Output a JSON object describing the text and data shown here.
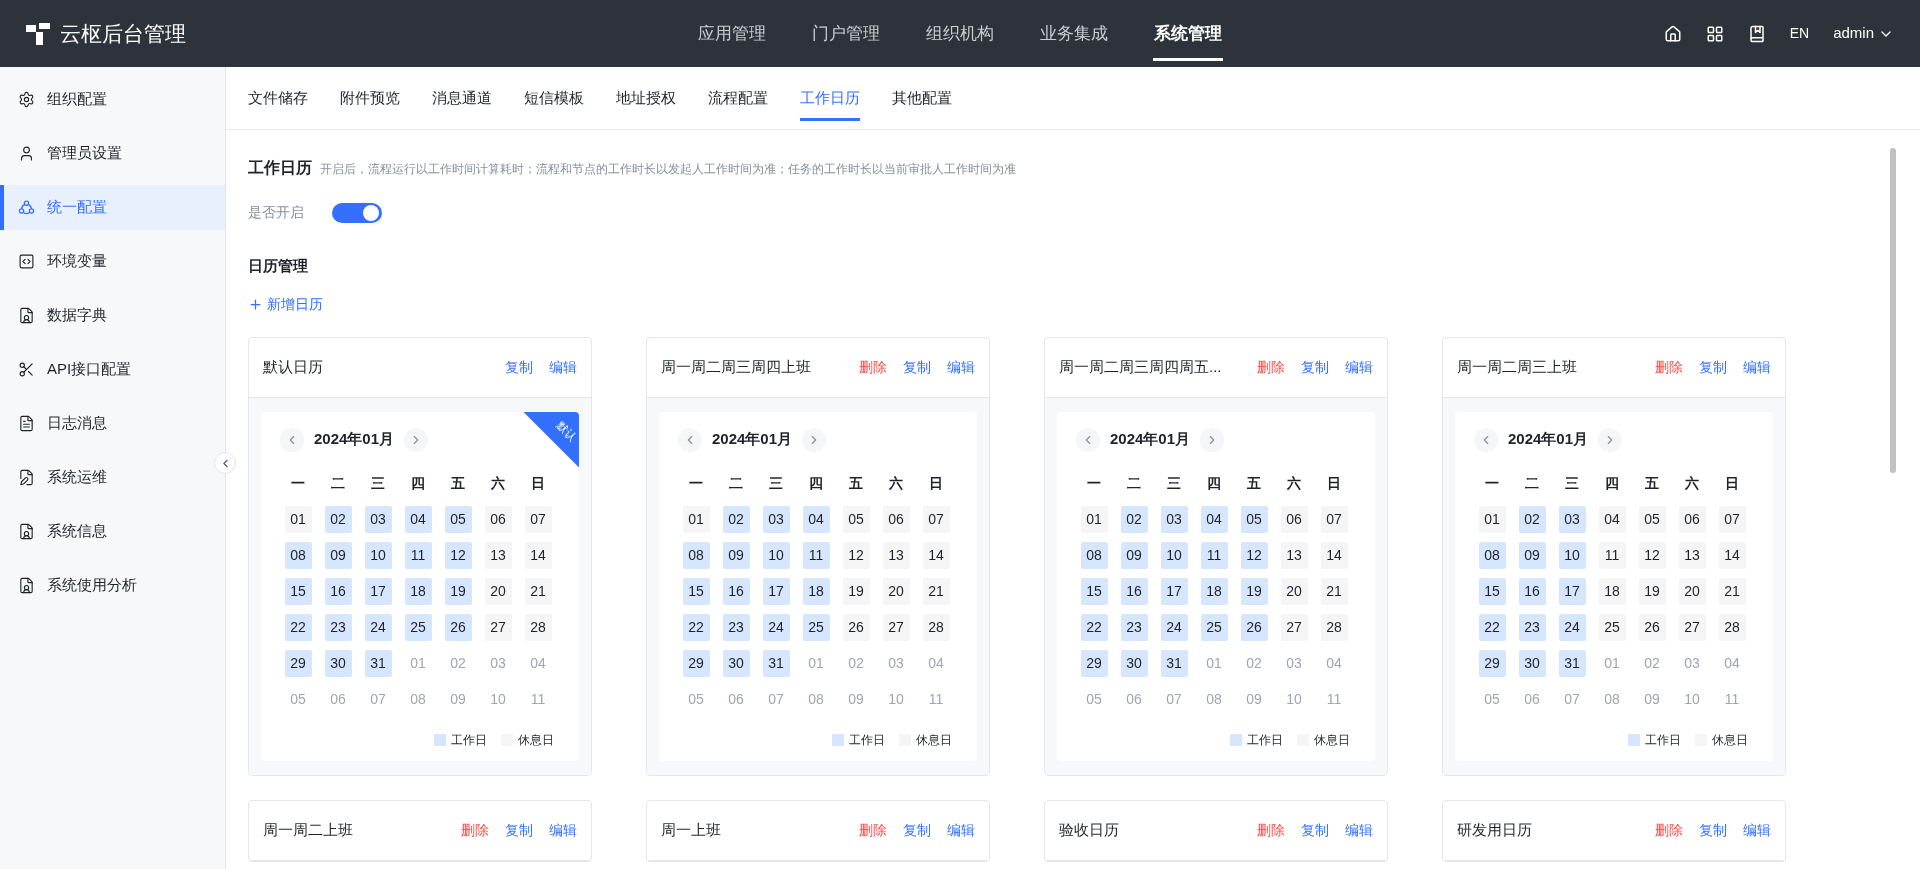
{
  "app": {
    "logo_text": "云枢后台管理"
  },
  "nav": [
    {
      "label": "应用管理",
      "selected": false
    },
    {
      "label": "门户管理",
      "selected": false
    },
    {
      "label": "组织机构",
      "selected": false
    },
    {
      "label": "业务集成",
      "selected": false
    },
    {
      "label": "系统管理",
      "selected": true
    }
  ],
  "header_right": {
    "lang": "EN",
    "user": "admin"
  },
  "sidebar": {
    "items": [
      {
        "label": "组织配置",
        "selected": false
      },
      {
        "label": "管理员设置",
        "selected": false
      },
      {
        "label": "统一配置",
        "selected": true
      },
      {
        "label": "环境变量",
        "selected": false
      },
      {
        "label": "数据字典",
        "selected": false
      },
      {
        "label": "API接口配置",
        "selected": false
      },
      {
        "label": "日志消息",
        "selected": false
      },
      {
        "label": "系统运维",
        "selected": false
      },
      {
        "label": "系统信息",
        "selected": false
      },
      {
        "label": "系统使用分析",
        "selected": false
      }
    ]
  },
  "tabs": [
    {
      "label": "文件储存",
      "selected": false
    },
    {
      "label": "附件预览",
      "selected": false
    },
    {
      "label": "消息通道",
      "selected": false
    },
    {
      "label": "短信模板",
      "selected": false
    },
    {
      "label": "地址授权",
      "selected": false
    },
    {
      "label": "流程配置",
      "selected": false
    },
    {
      "label": "工作日历",
      "selected": true
    },
    {
      "label": "其他配置",
      "selected": false
    }
  ],
  "section": {
    "title": "工作日历",
    "description": "开启后，流程运行以工作时间计算耗时；流程和节点的工作时长以发起人工作时间为准；任务的工作时长以当前审批人工作时间为准",
    "toggle_label": "是否开启",
    "enabled": true
  },
  "calendar_manager": {
    "title": "日历管理",
    "add_label": "新增日历"
  },
  "calendars": [
    {
      "title": "默认日历",
      "actions": [
        {
          "label": "复制",
          "kind": "copy"
        },
        {
          "label": "编辑",
          "kind": "edit"
        }
      ],
      "badge": "默认",
      "month": "2024年01月",
      "weekdays": [
        "一",
        "二",
        "三",
        "四",
        "五",
        "六",
        "日"
      ],
      "days": [
        {
          "d": "01",
          "kind": "rest"
        },
        {
          "d": "02",
          "kind": "work"
        },
        {
          "d": "03",
          "kind": "work"
        },
        {
          "d": "04",
          "kind": "work"
        },
        {
          "d": "05",
          "kind": "work"
        },
        {
          "d": "06",
          "kind": "rest"
        },
        {
          "d": "07",
          "kind": "rest"
        },
        {
          "d": "08",
          "kind": "work"
        },
        {
          "d": "09",
          "kind": "work"
        },
        {
          "d": "10",
          "kind": "work"
        },
        {
          "d": "11",
          "kind": "work"
        },
        {
          "d": "12",
          "kind": "work"
        },
        {
          "d": "13",
          "kind": "rest"
        },
        {
          "d": "14",
          "kind": "rest"
        },
        {
          "d": "15",
          "kind": "work"
        },
        {
          "d": "16",
          "kind": "work"
        },
        {
          "d": "17",
          "kind": "work"
        },
        {
          "d": "18",
          "kind": "work"
        },
        {
          "d": "19",
          "kind": "work"
        },
        {
          "d": "20",
          "kind": "rest"
        },
        {
          "d": "21",
          "kind": "rest"
        },
        {
          "d": "22",
          "kind": "work"
        },
        {
          "d": "23",
          "kind": "work"
        },
        {
          "d": "24",
          "kind": "work"
        },
        {
          "d": "25",
          "kind": "work"
        },
        {
          "d": "26",
          "kind": "work"
        },
        {
          "d": "27",
          "kind": "rest"
        },
        {
          "d": "28",
          "kind": "rest"
        },
        {
          "d": "29",
          "kind": "work"
        },
        {
          "d": "30",
          "kind": "work"
        },
        {
          "d": "31",
          "kind": "work"
        },
        {
          "d": "01",
          "kind": "other"
        },
        {
          "d": "02",
          "kind": "other"
        },
        {
          "d": "03",
          "kind": "other"
        },
        {
          "d": "04",
          "kind": "other"
        },
        {
          "d": "05",
          "kind": "other"
        },
        {
          "d": "06",
          "kind": "other"
        },
        {
          "d": "07",
          "kind": "other"
        },
        {
          "d": "08",
          "kind": "other"
        },
        {
          "d": "09",
          "kind": "other"
        },
        {
          "d": "10",
          "kind": "other"
        },
        {
          "d": "11",
          "kind": "other"
        }
      ],
      "legend": [
        {
          "label": "工作日",
          "kind": "work"
        },
        {
          "label": "休息日",
          "kind": "rest"
        }
      ]
    },
    {
      "title": "周一周二周三周四上班",
      "actions": [
        {
          "label": "删除",
          "kind": "delete"
        },
        {
          "label": "复制",
          "kind": "copy"
        },
        {
          "label": "编辑",
          "kind": "edit"
        }
      ],
      "month": "2024年01月",
      "weekdays": [
        "一",
        "二",
        "三",
        "四",
        "五",
        "六",
        "日"
      ],
      "days": [
        {
          "d": "01",
          "kind": "rest"
        },
        {
          "d": "02",
          "kind": "work"
        },
        {
          "d": "03",
          "kind": "work"
        },
        {
          "d": "04",
          "kind": "work"
        },
        {
          "d": "05",
          "kind": "rest"
        },
        {
          "d": "06",
          "kind": "rest"
        },
        {
          "d": "07",
          "kind": "rest"
        },
        {
          "d": "08",
          "kind": "work"
        },
        {
          "d": "09",
          "kind": "work"
        },
        {
          "d": "10",
          "kind": "work"
        },
        {
          "d": "11",
          "kind": "work"
        },
        {
          "d": "12",
          "kind": "rest"
        },
        {
          "d": "13",
          "kind": "rest"
        },
        {
          "d": "14",
          "kind": "rest"
        },
        {
          "d": "15",
          "kind": "work"
        },
        {
          "d": "16",
          "kind": "work"
        },
        {
          "d": "17",
          "kind": "work"
        },
        {
          "d": "18",
          "kind": "work"
        },
        {
          "d": "19",
          "kind": "rest"
        },
        {
          "d": "20",
          "kind": "rest"
        },
        {
          "d": "21",
          "kind": "rest"
        },
        {
          "d": "22",
          "kind": "work"
        },
        {
          "d": "23",
          "kind": "work"
        },
        {
          "d": "24",
          "kind": "work"
        },
        {
          "d": "25",
          "kind": "work"
        },
        {
          "d": "26",
          "kind": "rest"
        },
        {
          "d": "27",
          "kind": "rest"
        },
        {
          "d": "28",
          "kind": "rest"
        },
        {
          "d": "29",
          "kind": "work"
        },
        {
          "d": "30",
          "kind": "work"
        },
        {
          "d": "31",
          "kind": "work"
        },
        {
          "d": "01",
          "kind": "other"
        },
        {
          "d": "02",
          "kind": "other"
        },
        {
          "d": "03",
          "kind": "other"
        },
        {
          "d": "04",
          "kind": "other"
        },
        {
          "d": "05",
          "kind": "other"
        },
        {
          "d": "06",
          "kind": "other"
        },
        {
          "d": "07",
          "kind": "other"
        },
        {
          "d": "08",
          "kind": "other"
        },
        {
          "d": "09",
          "kind": "other"
        },
        {
          "d": "10",
          "kind": "other"
        },
        {
          "d": "11",
          "kind": "other"
        }
      ],
      "legend": [
        {
          "label": "工作日",
          "kind": "work"
        },
        {
          "label": "休息日",
          "kind": "rest"
        }
      ]
    },
    {
      "title": "周一周二周三周四周五...",
      "actions": [
        {
          "label": "删除",
          "kind": "delete"
        },
        {
          "label": "复制",
          "kind": "copy"
        },
        {
          "label": "编辑",
          "kind": "edit"
        }
      ],
      "month": "2024年01月",
      "weekdays": [
        "一",
        "二",
        "三",
        "四",
        "五",
        "六",
        "日"
      ],
      "days": [
        {
          "d": "01",
          "kind": "rest"
        },
        {
          "d": "02",
          "kind": "work"
        },
        {
          "d": "03",
          "kind": "work"
        },
        {
          "d": "04",
          "kind": "work"
        },
        {
          "d": "05",
          "kind": "work"
        },
        {
          "d": "06",
          "kind": "rest"
        },
        {
          "d": "07",
          "kind": "rest"
        },
        {
          "d": "08",
          "kind": "work"
        },
        {
          "d": "09",
          "kind": "work"
        },
        {
          "d": "10",
          "kind": "work"
        },
        {
          "d": "11",
          "kind": "work"
        },
        {
          "d": "12",
          "kind": "work"
        },
        {
          "d": "13",
          "kind": "rest"
        },
        {
          "d": "14",
          "kind": "rest"
        },
        {
          "d": "15",
          "kind": "work"
        },
        {
          "d": "16",
          "kind": "work"
        },
        {
          "d": "17",
          "kind": "work"
        },
        {
          "d": "18",
          "kind": "work"
        },
        {
          "d": "19",
          "kind": "work"
        },
        {
          "d": "20",
          "kind": "rest"
        },
        {
          "d": "21",
          "kind": "rest"
        },
        {
          "d": "22",
          "kind": "work"
        },
        {
          "d": "23",
          "kind": "work"
        },
        {
          "d": "24",
          "kind": "work"
        },
        {
          "d": "25",
          "kind": "work"
        },
        {
          "d": "26",
          "kind": "work"
        },
        {
          "d": "27",
          "kind": "rest"
        },
        {
          "d": "28",
          "kind": "rest"
        },
        {
          "d": "29",
          "kind": "work"
        },
        {
          "d": "30",
          "kind": "work"
        },
        {
          "d": "31",
          "kind": "work"
        },
        {
          "d": "01",
          "kind": "other"
        },
        {
          "d": "02",
          "kind": "other"
        },
        {
          "d": "03",
          "kind": "other"
        },
        {
          "d": "04",
          "kind": "other"
        },
        {
          "d": "05",
          "kind": "other"
        },
        {
          "d": "06",
          "kind": "other"
        },
        {
          "d": "07",
          "kind": "other"
        },
        {
          "d": "08",
          "kind": "other"
        },
        {
          "d": "09",
          "kind": "other"
        },
        {
          "d": "10",
          "kind": "other"
        },
        {
          "d": "11",
          "kind": "other"
        }
      ],
      "legend": [
        {
          "label": "工作日",
          "kind": "work"
        },
        {
          "label": "休息日",
          "kind": "rest"
        }
      ]
    },
    {
      "title": "周一周二周三上班",
      "actions": [
        {
          "label": "删除",
          "kind": "delete"
        },
        {
          "label": "复制",
          "kind": "copy"
        },
        {
          "label": "编辑",
          "kind": "edit"
        }
      ],
      "month": "2024年01月",
      "weekdays": [
        "一",
        "二",
        "三",
        "四",
        "五",
        "六",
        "日"
      ],
      "days": [
        {
          "d": "01",
          "kind": "rest"
        },
        {
          "d": "02",
          "kind": "work"
        },
        {
          "d": "03",
          "kind": "work"
        },
        {
          "d": "04",
          "kind": "rest"
        },
        {
          "d": "05",
          "kind": "rest"
        },
        {
          "d": "06",
          "kind": "rest"
        },
        {
          "d": "07",
          "kind": "rest"
        },
        {
          "d": "08",
          "kind": "work"
        },
        {
          "d": "09",
          "kind": "work"
        },
        {
          "d": "10",
          "kind": "work"
        },
        {
          "d": "11",
          "kind": "rest"
        },
        {
          "d": "12",
          "kind": "rest"
        },
        {
          "d": "13",
          "kind": "rest"
        },
        {
          "d": "14",
          "kind": "rest"
        },
        {
          "d": "15",
          "kind": "work"
        },
        {
          "d": "16",
          "kind": "work"
        },
        {
          "d": "17",
          "kind": "work"
        },
        {
          "d": "18",
          "kind": "rest"
        },
        {
          "d": "19",
          "kind": "rest"
        },
        {
          "d": "20",
          "kind": "rest"
        },
        {
          "d": "21",
          "kind": "rest"
        },
        {
          "d": "22",
          "kind": "work"
        },
        {
          "d": "23",
          "kind": "work"
        },
        {
          "d": "24",
          "kind": "work"
        },
        {
          "d": "25",
          "kind": "rest"
        },
        {
          "d": "26",
          "kind": "rest"
        },
        {
          "d": "27",
          "kind": "rest"
        },
        {
          "d": "28",
          "kind": "rest"
        },
        {
          "d": "29",
          "kind": "work"
        },
        {
          "d": "30",
          "kind": "work"
        },
        {
          "d": "31",
          "kind": "work"
        },
        {
          "d": "01",
          "kind": "other"
        },
        {
          "d": "02",
          "kind": "other"
        },
        {
          "d": "03",
          "kind": "other"
        },
        {
          "d": "04",
          "kind": "other"
        },
        {
          "d": "05",
          "kind": "other"
        },
        {
          "d": "06",
          "kind": "other"
        },
        {
          "d": "07",
          "kind": "other"
        },
        {
          "d": "08",
          "kind": "other"
        },
        {
          "d": "09",
          "kind": "other"
        },
        {
          "d": "10",
          "kind": "other"
        },
        {
          "d": "11",
          "kind": "other"
        }
      ],
      "legend": [
        {
          "label": "工作日",
          "kind": "work"
        },
        {
          "label": "休息日",
          "kind": "rest"
        }
      ]
    },
    {
      "title": "周一周二上班",
      "actions": [
        {
          "label": "删除",
          "kind": "delete"
        },
        {
          "label": "复制",
          "kind": "copy"
        },
        {
          "label": "编辑",
          "kind": "edit"
        }
      ]
    },
    {
      "title": "周一上班",
      "actions": [
        {
          "label": "删除",
          "kind": "delete"
        },
        {
          "label": "复制",
          "kind": "copy"
        },
        {
          "label": "编辑",
          "kind": "edit"
        }
      ]
    },
    {
      "title": "验收日历",
      "actions": [
        {
          "label": "删除",
          "kind": "delete"
        },
        {
          "label": "复制",
          "kind": "copy"
        },
        {
          "label": "编辑",
          "kind": "edit"
        }
      ]
    },
    {
      "title": "研发用日历",
      "actions": [
        {
          "label": "删除",
          "kind": "delete"
        },
        {
          "label": "复制",
          "kind": "copy"
        },
        {
          "label": "编辑",
          "kind": "edit"
        }
      ]
    }
  ]
}
